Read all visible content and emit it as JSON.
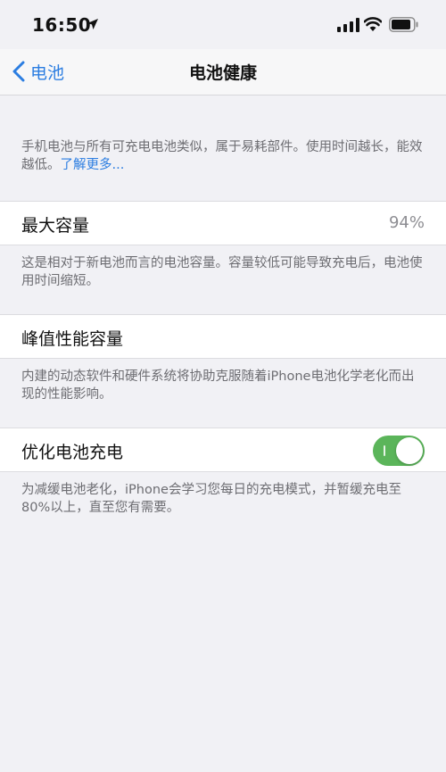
{
  "status_bar": {
    "time": "16:50",
    "icons": [
      "location-arrow-icon",
      "signal-icon",
      "wifi-icon",
      "battery-icon"
    ]
  },
  "nav": {
    "back_label": "电池",
    "title": "电池健康"
  },
  "intro": {
    "text": "手机电池与所有可充电电池类似，属于易耗部件。使用时间越长，能效越低。",
    "link": "了解更多..."
  },
  "max_capacity": {
    "label": "最大容量",
    "value": "94%",
    "footnote": "这是相对于新电池而言的电池容量。容量较低可能导致充电后，电池使用时间缩短。"
  },
  "peak_performance": {
    "label": "峰值性能容量",
    "footnote": "内建的动态软件和硬件系统将协助克服随着iPhone电池化学老化而出现的性能影响。"
  },
  "optimized_charging": {
    "label": "优化电池充电",
    "enabled": true,
    "footnote": "为减缓电池老化，iPhone会学习您每日的充电模式，并暂缓充电至80%以上，直至您有需要。"
  },
  "colors": {
    "accent": "#2b7de1",
    "toggle_on": "#5bb55a",
    "background": "#f1f1f5"
  }
}
